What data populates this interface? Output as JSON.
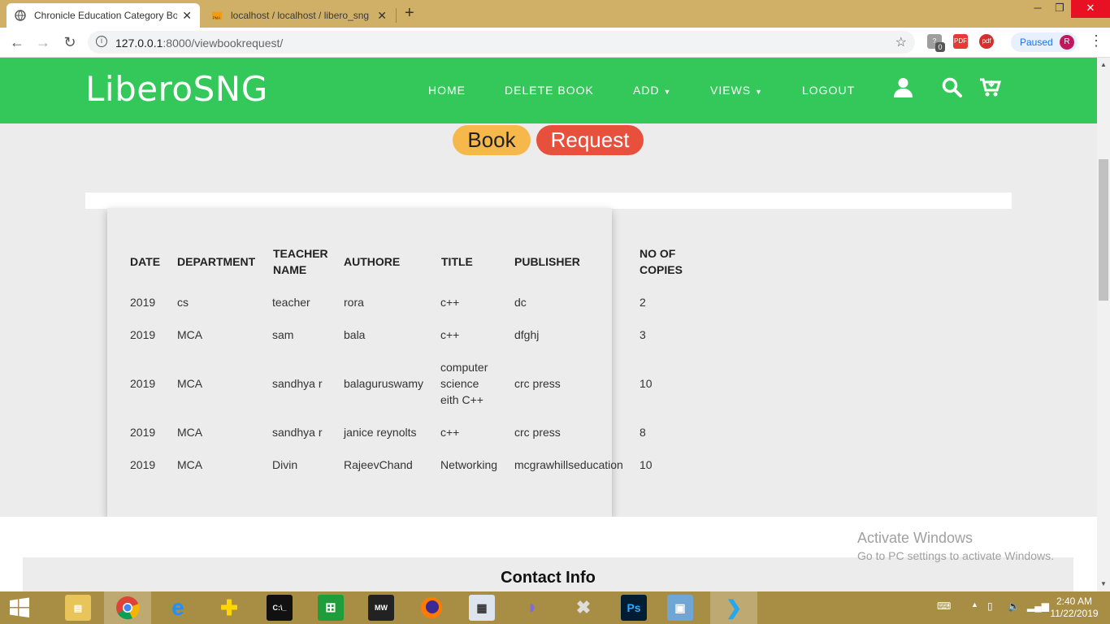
{
  "browser": {
    "tabs": [
      {
        "title": "Chronicle Education Category Bo",
        "active": true
      },
      {
        "title": "localhost / localhost / libero_sng",
        "active": false
      }
    ],
    "url_host": "127.0.0.1",
    "url_rest": ":8000/viewbookrequest/",
    "profile_status": "Paused",
    "profile_initial": "R",
    "extension_badge": "0"
  },
  "site": {
    "logo": "LiberoSNG",
    "nav": [
      "HOME",
      "DELETE BOOK",
      "ADD",
      "VIEWS",
      "LOGOUT"
    ],
    "brand_color": "#34c85a"
  },
  "page": {
    "title_word1": "Book",
    "title_word2": "Request"
  },
  "table": {
    "headers": [
      [
        "DATE"
      ],
      [
        "DEPARTMENT"
      ],
      [
        "TEACHER",
        "NAME"
      ],
      [
        "AUTHORE"
      ],
      [
        "TITLE"
      ],
      [
        "PUBLISHER"
      ],
      [
        "NO OF",
        "COPIES"
      ]
    ],
    "rows": [
      [
        "2019",
        "cs",
        "teacher",
        "rora",
        [
          "c++"
        ],
        "dc",
        "2"
      ],
      [
        "2019",
        "MCA",
        "sam",
        "bala",
        [
          "c++"
        ],
        "dfghj",
        "3"
      ],
      [
        "2019",
        "MCA",
        "sandhya r",
        "balaguruswamy",
        [
          "computer",
          "science",
          "eith C++"
        ],
        "crc press",
        "10"
      ],
      [
        "2019",
        "MCA",
        "sandhya r",
        "janice reynolts",
        [
          "c++"
        ],
        "crc press",
        "8"
      ],
      [
        "2019",
        "MCA",
        "Divin",
        "RajeevChand",
        [
          "Networking"
        ],
        "mcgrawhillseducation",
        "10"
      ]
    ]
  },
  "footer": {
    "contact_title": "Contact Info"
  },
  "watermark": {
    "line1": "Activate Windows",
    "line2": "Go to PC settings to activate Windows."
  },
  "taskbar": {
    "time": "2:40 AM",
    "date": "11/22/2019",
    "icons": [
      "start",
      "file-explorer",
      "chrome",
      "internet-explorer",
      "app-plus",
      "cmd",
      "store",
      "nfs-mw",
      "firefox",
      "reader",
      "dolphin",
      "tools",
      "photoshop",
      "photos",
      "vscode"
    ]
  }
}
